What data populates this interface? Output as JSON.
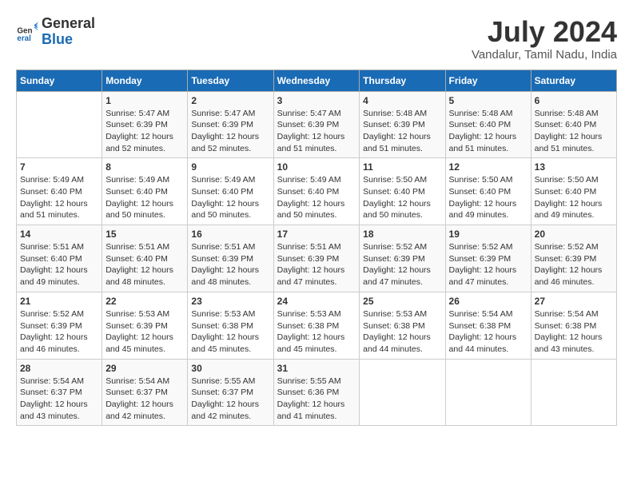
{
  "logo": {
    "line1": "General",
    "line2": "Blue"
  },
  "title": "July 2024",
  "subtitle": "Vandalur, Tamil Nadu, India",
  "headers": [
    "Sunday",
    "Monday",
    "Tuesday",
    "Wednesday",
    "Thursday",
    "Friday",
    "Saturday"
  ],
  "weeks": [
    [
      {
        "day": "",
        "info": ""
      },
      {
        "day": "1",
        "info": "Sunrise: 5:47 AM\nSunset: 6:39 PM\nDaylight: 12 hours\nand 52 minutes."
      },
      {
        "day": "2",
        "info": "Sunrise: 5:47 AM\nSunset: 6:39 PM\nDaylight: 12 hours\nand 52 minutes."
      },
      {
        "day": "3",
        "info": "Sunrise: 5:47 AM\nSunset: 6:39 PM\nDaylight: 12 hours\nand 51 minutes."
      },
      {
        "day": "4",
        "info": "Sunrise: 5:48 AM\nSunset: 6:39 PM\nDaylight: 12 hours\nand 51 minutes."
      },
      {
        "day": "5",
        "info": "Sunrise: 5:48 AM\nSunset: 6:40 PM\nDaylight: 12 hours\nand 51 minutes."
      },
      {
        "day": "6",
        "info": "Sunrise: 5:48 AM\nSunset: 6:40 PM\nDaylight: 12 hours\nand 51 minutes."
      }
    ],
    [
      {
        "day": "7",
        "info": "Sunrise: 5:49 AM\nSunset: 6:40 PM\nDaylight: 12 hours\nand 51 minutes."
      },
      {
        "day": "8",
        "info": "Sunrise: 5:49 AM\nSunset: 6:40 PM\nDaylight: 12 hours\nand 50 minutes."
      },
      {
        "day": "9",
        "info": "Sunrise: 5:49 AM\nSunset: 6:40 PM\nDaylight: 12 hours\nand 50 minutes."
      },
      {
        "day": "10",
        "info": "Sunrise: 5:49 AM\nSunset: 6:40 PM\nDaylight: 12 hours\nand 50 minutes."
      },
      {
        "day": "11",
        "info": "Sunrise: 5:50 AM\nSunset: 6:40 PM\nDaylight: 12 hours\nand 50 minutes."
      },
      {
        "day": "12",
        "info": "Sunrise: 5:50 AM\nSunset: 6:40 PM\nDaylight: 12 hours\nand 49 minutes."
      },
      {
        "day": "13",
        "info": "Sunrise: 5:50 AM\nSunset: 6:40 PM\nDaylight: 12 hours\nand 49 minutes."
      }
    ],
    [
      {
        "day": "14",
        "info": "Sunrise: 5:51 AM\nSunset: 6:40 PM\nDaylight: 12 hours\nand 49 minutes."
      },
      {
        "day": "15",
        "info": "Sunrise: 5:51 AM\nSunset: 6:40 PM\nDaylight: 12 hours\nand 48 minutes."
      },
      {
        "day": "16",
        "info": "Sunrise: 5:51 AM\nSunset: 6:39 PM\nDaylight: 12 hours\nand 48 minutes."
      },
      {
        "day": "17",
        "info": "Sunrise: 5:51 AM\nSunset: 6:39 PM\nDaylight: 12 hours\nand 47 minutes."
      },
      {
        "day": "18",
        "info": "Sunrise: 5:52 AM\nSunset: 6:39 PM\nDaylight: 12 hours\nand 47 minutes."
      },
      {
        "day": "19",
        "info": "Sunrise: 5:52 AM\nSunset: 6:39 PM\nDaylight: 12 hours\nand 47 minutes."
      },
      {
        "day": "20",
        "info": "Sunrise: 5:52 AM\nSunset: 6:39 PM\nDaylight: 12 hours\nand 46 minutes."
      }
    ],
    [
      {
        "day": "21",
        "info": "Sunrise: 5:52 AM\nSunset: 6:39 PM\nDaylight: 12 hours\nand 46 minutes."
      },
      {
        "day": "22",
        "info": "Sunrise: 5:53 AM\nSunset: 6:39 PM\nDaylight: 12 hours\nand 45 minutes."
      },
      {
        "day": "23",
        "info": "Sunrise: 5:53 AM\nSunset: 6:38 PM\nDaylight: 12 hours\nand 45 minutes."
      },
      {
        "day": "24",
        "info": "Sunrise: 5:53 AM\nSunset: 6:38 PM\nDaylight: 12 hours\nand 45 minutes."
      },
      {
        "day": "25",
        "info": "Sunrise: 5:53 AM\nSunset: 6:38 PM\nDaylight: 12 hours\nand 44 minutes."
      },
      {
        "day": "26",
        "info": "Sunrise: 5:54 AM\nSunset: 6:38 PM\nDaylight: 12 hours\nand 44 minutes."
      },
      {
        "day": "27",
        "info": "Sunrise: 5:54 AM\nSunset: 6:38 PM\nDaylight: 12 hours\nand 43 minutes."
      }
    ],
    [
      {
        "day": "28",
        "info": "Sunrise: 5:54 AM\nSunset: 6:37 PM\nDaylight: 12 hours\nand 43 minutes."
      },
      {
        "day": "29",
        "info": "Sunrise: 5:54 AM\nSunset: 6:37 PM\nDaylight: 12 hours\nand 42 minutes."
      },
      {
        "day": "30",
        "info": "Sunrise: 5:55 AM\nSunset: 6:37 PM\nDaylight: 12 hours\nand 42 minutes."
      },
      {
        "day": "31",
        "info": "Sunrise: 5:55 AM\nSunset: 6:36 PM\nDaylight: 12 hours\nand 41 minutes."
      },
      {
        "day": "",
        "info": ""
      },
      {
        "day": "",
        "info": ""
      },
      {
        "day": "",
        "info": ""
      }
    ]
  ]
}
